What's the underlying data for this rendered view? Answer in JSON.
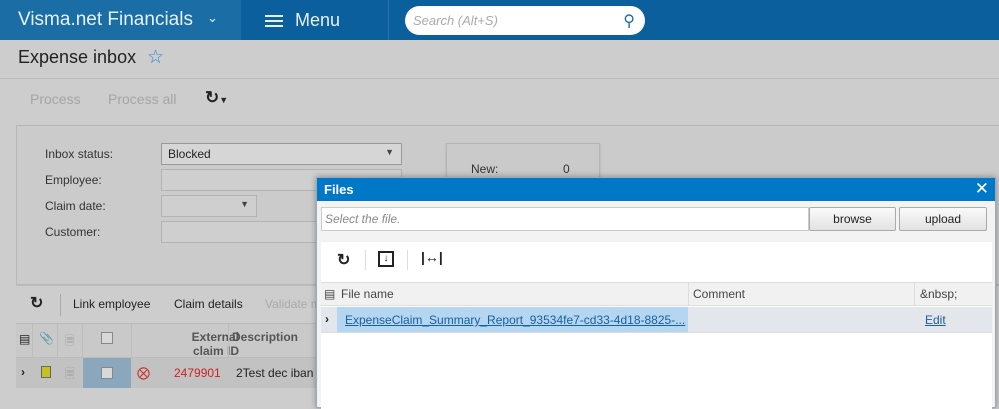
{
  "header": {
    "brand": "Visma.net Financials",
    "menu_label": "Menu",
    "search_placeholder": "Search (Alt+S)"
  },
  "page": {
    "title": "Expense inbox"
  },
  "toolbar": {
    "process": "Process",
    "process_all": "Process all"
  },
  "form": {
    "inbox_status_label": "Inbox status:",
    "inbox_status_value": "Blocked",
    "employee_label": "Employee:",
    "claim_date_label": "Claim date:",
    "customer_label": "Customer:"
  },
  "stats": {
    "new_label": "New:",
    "new_value": "0"
  },
  "grid_toolbar": {
    "link_employee": "Link employee",
    "claim_details": "Claim details",
    "validate": "Validate m"
  },
  "grid": {
    "col_external_1": "External",
    "col_external_2": "claim ID",
    "col_description": "Description",
    "rows": [
      {
        "external_claim_id": "2479901",
        "description": "2Test dec iban"
      }
    ]
  },
  "files_dialog": {
    "title": "Files",
    "file_placeholder": "Select the file.",
    "browse": "browse",
    "upload": "upload",
    "columns": {
      "file_name": "File name",
      "comment": "Comment",
      "extra": "&nbsp;"
    },
    "rows": [
      {
        "file_name": "ExpenseClaim_Summary_Report_93534fe7-cd33-4d18-8825-...",
        "comment": "",
        "action": "Edit"
      }
    ]
  }
}
